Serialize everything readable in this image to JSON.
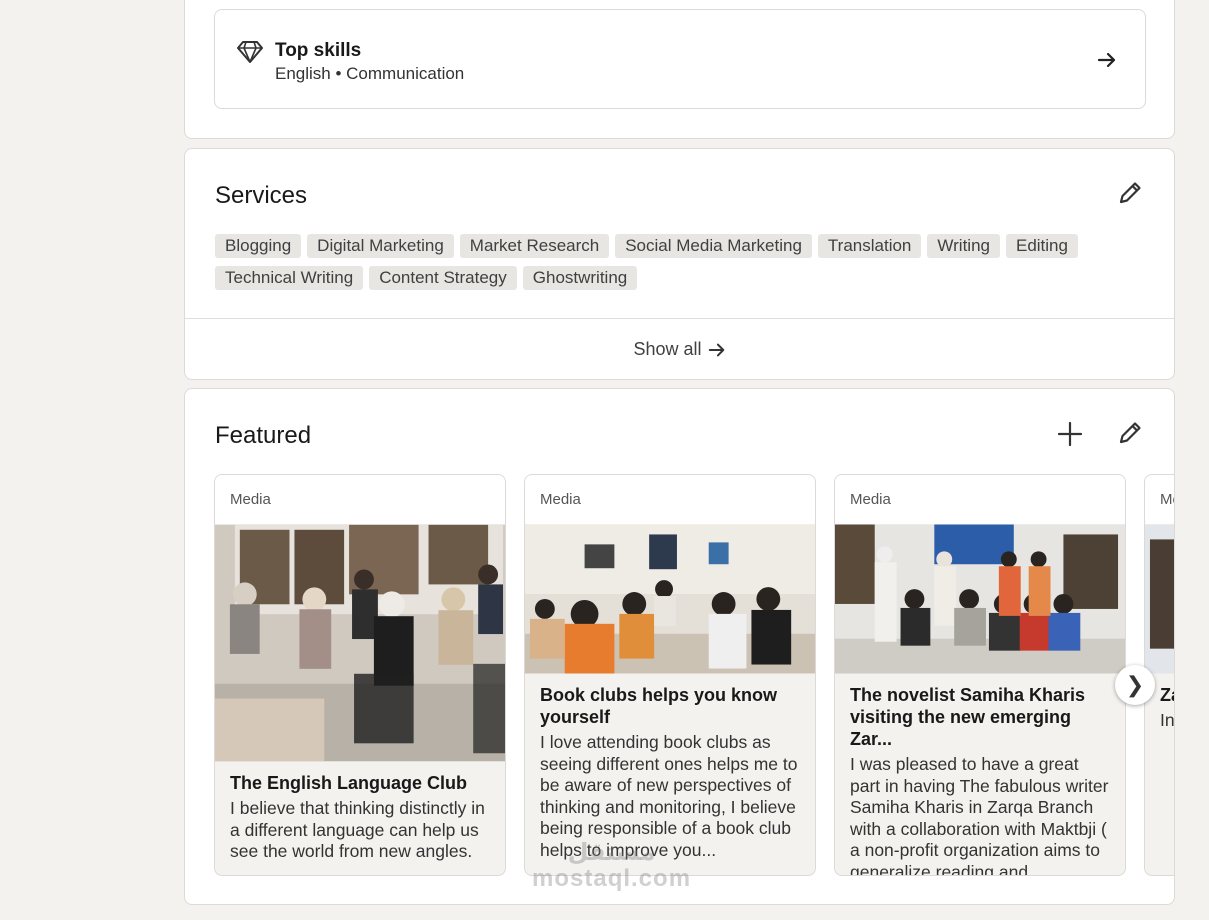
{
  "top_skills": {
    "title": "Top skills",
    "skills_line": "English • Communication"
  },
  "services": {
    "title": "Services",
    "tags": [
      "Blogging",
      "Digital Marketing",
      "Market Research",
      "Social Media Marketing",
      "Translation",
      "Writing",
      "Editing",
      "Technical Writing",
      "Content Strategy",
      "Ghostwriting"
    ],
    "show_all_label": "Show all"
  },
  "featured": {
    "title": "Featured",
    "items": [
      {
        "kind": "Media",
        "title": "The English Language Club",
        "description": "I believe that thinking distinctly in a different language can help us see the world from new angles."
      },
      {
        "kind": "Media",
        "title": "Book clubs helps you know yourself",
        "description": "I love attending book clubs as seeing different ones helps me to be aware of new perspectives of thinking and monitoring, I believe being responsible of a book club helps to improve you..."
      },
      {
        "kind": "Media",
        "title": "The novelist Samiha Kharis visiting the new emerging Zar...",
        "description": "I was pleased to have a great part in having The fabulous writer Samiha Kharis in Zarqa Branch with a collaboration with Maktbji ( a non-profit organization aims to generalize reading and ..."
      },
      {
        "kind": "Media",
        "title": "Za... vis...",
        "description": "In... th... hi... an... Hi... th..."
      }
    ]
  },
  "watermark": {
    "arabic": "مستقل",
    "latin": "mostaql.com"
  },
  "icons": {
    "diamond": "diamond-icon",
    "arrow": "arrow-right-icon",
    "pencil": "pencil-icon",
    "plus": "plus-icon",
    "next": "chevron-right-icon"
  }
}
